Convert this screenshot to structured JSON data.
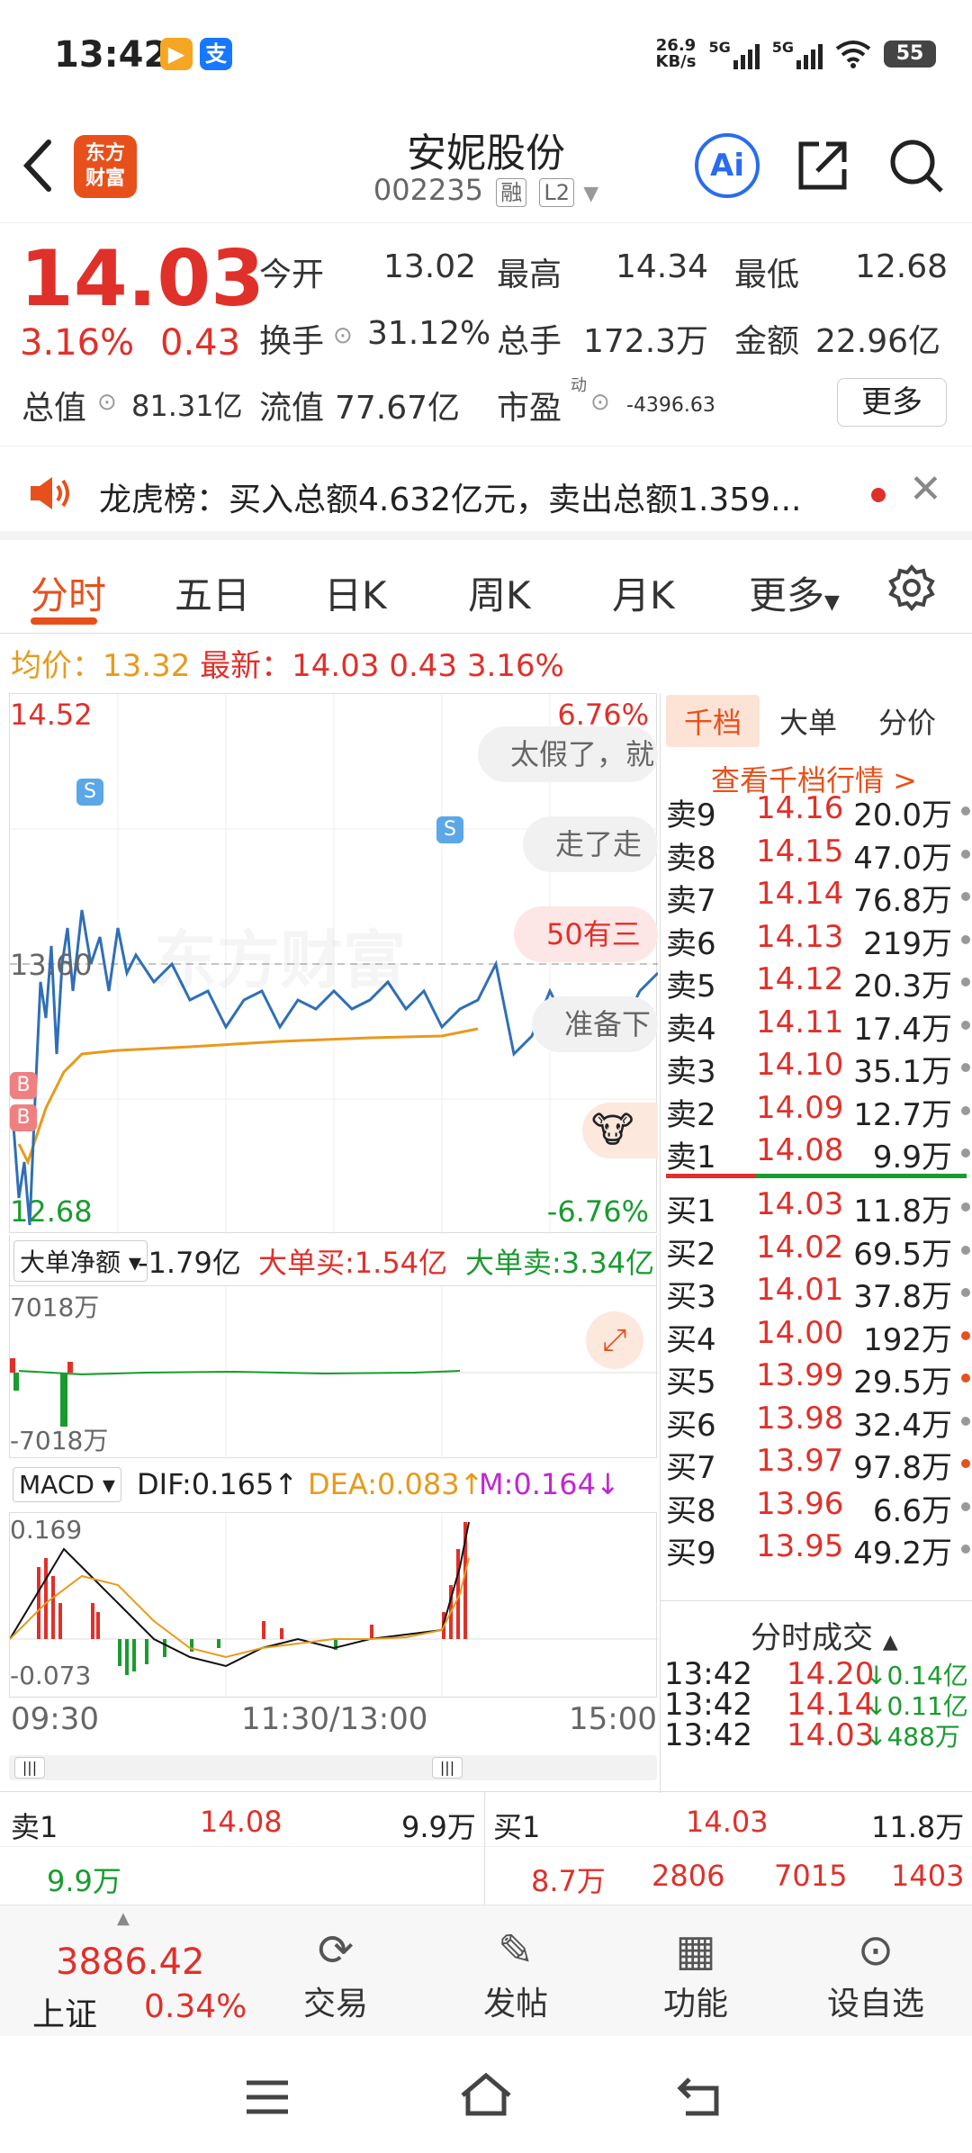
{
  "status_bar": {
    "time": "13:42",
    "net_speed": "26.9",
    "net_unit": "KB/s",
    "sig1": "5G",
    "sig2": "5G",
    "battery": "55"
  },
  "header": {
    "back_icon": "chevron-left-icon",
    "logo_line1": "东方",
    "logo_line2": "财富",
    "stock_name": "安妮股份",
    "stock_code": "002235",
    "tag_margin": "融",
    "tag_l2": "L2",
    "ai_label": "Ai"
  },
  "quote": {
    "price": "14.03",
    "pct": "3.16%",
    "change": "0.43",
    "open_label": "今开",
    "open": "13.02",
    "high_label": "最高",
    "high": "14.34",
    "low_label": "最低",
    "low": "12.68",
    "turnover_label": "换手",
    "turnover": "31.12%",
    "volume_label": "总手",
    "volume": "172.3万",
    "amount_label": "金额",
    "amount": "22.96亿",
    "mktcap_label": "总值",
    "mktcap": "81.31亿",
    "float_label": "流值",
    "float_cap": "77.67亿",
    "pe_label": "市盈",
    "pe_sup": "动",
    "pe": "-4396.63",
    "more": "更多"
  },
  "notice": {
    "text": "龙虎榜：买入总额4.632亿元，卖出总额1.359..."
  },
  "tabs": [
    "分时",
    "五日",
    "日K",
    "周K",
    "月K",
    "更多"
  ],
  "infoline": {
    "avg_label": "均价：",
    "avg": "13.32",
    "last_label": "最新：",
    "last": "14.03",
    "chg": "0.43",
    "pct": "3.16%"
  },
  "chart": {
    "y_top": "14.52",
    "y_mid": "13.60",
    "y_bottom": "12.68",
    "pct_top": "6.76%",
    "pct_bottom": "-6.76%",
    "watermark": "东方财富",
    "bubbles": [
      "太假了，就",
      "走了走",
      "50有三",
      "准备下"
    ],
    "bigorder_select": "大单净额",
    "bigorder_net": "-1.79亿",
    "bigorder_buy": "大单买:1.54亿",
    "bigorder_sell": "大单卖:3.34亿",
    "bo_top": "7018万",
    "bo_bottom": "-7018万",
    "macd_select": "MACD",
    "dif": "DIF:0.165",
    "dea": "DEA:0.083",
    "m": "M:0.164",
    "macd_top": "0.169",
    "macd_bottom": "-0.073",
    "time_start": "09:30",
    "time_mid": "11:30/13:00",
    "time_end": "15:00",
    "marker_s": "S",
    "marker_b": "B"
  },
  "orderbook": {
    "tabs": [
      "千档",
      "大单",
      "分价"
    ],
    "link": "查看千档行情 >",
    "asks": [
      {
        "l": "卖9",
        "p": "14.16",
        "v": "20.0万",
        "dot": "#999999"
      },
      {
        "l": "卖8",
        "p": "14.15",
        "v": "47.0万",
        "dot": "#999999"
      },
      {
        "l": "卖7",
        "p": "14.14",
        "v": "76.8万",
        "dot": "#999999"
      },
      {
        "l": "卖6",
        "p": "14.13",
        "v": "219万",
        "dot": "#999999"
      },
      {
        "l": "卖5",
        "p": "14.12",
        "v": "20.3万",
        "dot": "#999999"
      },
      {
        "l": "卖4",
        "p": "14.11",
        "v": "17.4万",
        "dot": "#999999"
      },
      {
        "l": "卖3",
        "p": "14.10",
        "v": "35.1万",
        "dot": "#999999"
      },
      {
        "l": "卖2",
        "p": "14.09",
        "v": "12.7万",
        "dot": "#999999"
      },
      {
        "l": "卖1",
        "p": "14.08",
        "v": "9.9万",
        "dot": "#999999"
      }
    ],
    "bids": [
      {
        "l": "买1",
        "p": "14.03",
        "v": "11.8万",
        "dot": "#999999"
      },
      {
        "l": "买2",
        "p": "14.02",
        "v": "69.5万",
        "dot": "#999999"
      },
      {
        "l": "买3",
        "p": "14.01",
        "v": "37.8万",
        "dot": "#999999"
      },
      {
        "l": "买4",
        "p": "14.00",
        "v": "192万",
        "dot": "#e8501b"
      },
      {
        "l": "买5",
        "p": "13.99",
        "v": "29.5万",
        "dot": "#e8501b"
      },
      {
        "l": "买6",
        "p": "13.98",
        "v": "32.4万",
        "dot": "#999999"
      },
      {
        "l": "买7",
        "p": "13.97",
        "v": "97.8万",
        "dot": "#e8501b"
      },
      {
        "l": "买8",
        "p": "13.96",
        "v": "6.6万",
        "dot": "#999999"
      },
      {
        "l": "买9",
        "p": "13.95",
        "v": "49.2万",
        "dot": "#999999"
      }
    ],
    "trades_title": "分时成交",
    "trades": [
      {
        "t": "13:42",
        "p": "14.20",
        "v": "↓0.14亿"
      },
      {
        "t": "13:42",
        "p": "14.14",
        "v": "↓0.11亿"
      },
      {
        "t": "13:42",
        "p": "14.03",
        "v": "↓488万"
      }
    ]
  },
  "bottom_quote": {
    "ask_label": "卖1",
    "ask_price": "14.08",
    "ask_vol": "9.9万",
    "ask_sub": "9.9万",
    "bid_label": "买1",
    "bid_price": "14.03",
    "bid_vol": "11.8万",
    "sub1": "8.7万",
    "sub2": "2806",
    "sub3": "7015",
    "sub4": "1403"
  },
  "bottom_nav": {
    "index_value": "3886.42",
    "index_name": "上证",
    "index_pct": "0.34%",
    "items": [
      "交易",
      "发帖",
      "功能",
      "设自选"
    ]
  }
}
